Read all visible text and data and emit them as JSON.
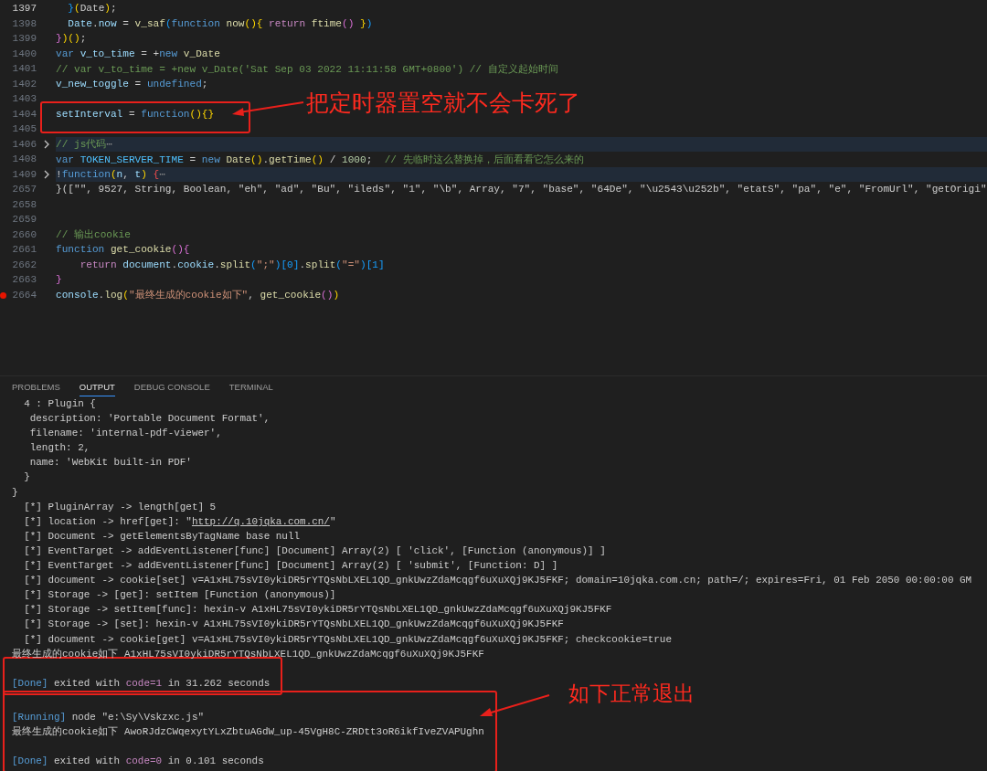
{
  "code_lines": [
    {
      "number": "1397",
      "current": true,
      "folded": false,
      "breakpoint": false,
      "segments": [
        {
          "kind": "b3",
          "text": "  }"
        },
        {
          "kind": "b1",
          "text": "("
        },
        {
          "kind": "p",
          "text": "Date"
        },
        {
          "kind": "b1",
          "text": ")"
        },
        {
          "kind": "p",
          "text": ";"
        }
      ]
    },
    {
      "number": "1398",
      "current": false,
      "folded": false,
      "breakpoint": false,
      "segments": [
        {
          "kind": "var",
          "text": "  Date"
        },
        {
          "kind": "p",
          "text": "."
        },
        {
          "kind": "var",
          "text": "now"
        },
        {
          "kind": "p",
          "text": " = "
        },
        {
          "kind": "fn",
          "text": "v_saf"
        },
        {
          "kind": "b3",
          "text": "("
        },
        {
          "kind": "kw",
          "text": "function "
        },
        {
          "kind": "fn",
          "text": "now"
        },
        {
          "kind": "b1",
          "text": "(){"
        },
        {
          "kind": "ctl",
          "text": " return "
        },
        {
          "kind": "fn",
          "text": "ftime"
        },
        {
          "kind": "b2",
          "text": "()"
        },
        {
          "kind": "b1",
          "text": " }"
        },
        {
          "kind": "b3",
          "text": ")"
        }
      ]
    },
    {
      "number": "1399",
      "current": false,
      "folded": false,
      "breakpoint": false,
      "segments": [
        {
          "kind": "b2",
          "text": "}"
        },
        {
          "kind": "b1",
          "text": ")()"
        },
        {
          "kind": "p",
          "text": ";"
        }
      ]
    },
    {
      "number": "1400",
      "current": false,
      "folded": false,
      "breakpoint": false,
      "segments": [
        {
          "kind": "kw",
          "text": "var "
        },
        {
          "kind": "var",
          "text": "v_to_time"
        },
        {
          "kind": "p",
          "text": " = +"
        },
        {
          "kind": "kw",
          "text": "new "
        },
        {
          "kind": "fn",
          "text": "v_Date"
        }
      ]
    },
    {
      "number": "1401",
      "current": false,
      "folded": false,
      "breakpoint": false,
      "segments": [
        {
          "kind": "cmt",
          "text": "// var v_to_time = +new v_Date('Sat Sep 03 2022 11:11:58 GMT+0800') // 自定义起始时间"
        }
      ]
    },
    {
      "number": "1402",
      "current": false,
      "folded": false,
      "breakpoint": false,
      "segments": [
        {
          "kind": "var",
          "text": "v_new_toggle"
        },
        {
          "kind": "p",
          "text": " = "
        },
        {
          "kind": "kw",
          "text": "undefined"
        },
        {
          "kind": "p",
          "text": ";"
        }
      ]
    },
    {
      "number": "1403",
      "current": false,
      "folded": false,
      "breakpoint": false
    },
    {
      "number": "1404",
      "current": false,
      "folded": false,
      "breakpoint": false,
      "segments": [
        {
          "kind": "var",
          "text": "setInterval"
        },
        {
          "kind": "p",
          "text": " = "
        },
        {
          "kind": "kw",
          "text": "function"
        },
        {
          "kind": "b1",
          "text": "(){}"
        }
      ]
    },
    {
      "number": "1405",
      "current": false,
      "folded": false,
      "breakpoint": false
    },
    {
      "number": "1406",
      "current": false,
      "folded": true,
      "breakpoint": false,
      "segments": [
        {
          "kind": "cmt",
          "text": "// js代码"
        },
        {
          "kind": "fold",
          "text": "⋯"
        }
      ]
    },
    {
      "number": "1408",
      "current": false,
      "folded": false,
      "breakpoint": false,
      "segments": [
        {
          "kind": "kw",
          "text": "var "
        },
        {
          "kind": "const",
          "text": "TOKEN_SERVER_TIME"
        },
        {
          "kind": "p",
          "text": " = "
        },
        {
          "kind": "kw",
          "text": "new "
        },
        {
          "kind": "fn",
          "text": "Date"
        },
        {
          "kind": "b1",
          "text": "()"
        },
        {
          "kind": "p",
          "text": "."
        },
        {
          "kind": "fn",
          "text": "getTime"
        },
        {
          "kind": "b1",
          "text": "()"
        },
        {
          "kind": "p",
          "text": " / "
        },
        {
          "kind": "num",
          "text": "1000"
        },
        {
          "kind": "p",
          "text": ";"
        },
        {
          "kind": "cmt",
          "text": "  // 先临时这么替换掉，后面看看它怎么来的"
        }
      ]
    },
    {
      "number": "1409",
      "current": false,
      "folded": true,
      "breakpoint": false,
      "segments": [
        {
          "kind": "p",
          "text": "!"
        },
        {
          "kind": "kw",
          "text": "function"
        },
        {
          "kind": "b1",
          "text": "("
        },
        {
          "kind": "var",
          "text": "n"
        },
        {
          "kind": "p",
          "text": ", "
        },
        {
          "kind": "var",
          "text": "t"
        },
        {
          "kind": "b1",
          "text": ")"
        },
        {
          "kind": "red",
          "text": " {"
        },
        {
          "kind": "fold",
          "text": "⋯"
        }
      ]
    },
    {
      "number": "2657",
      "current": false,
      "folded": false,
      "breakpoint": false,
      "segments": [
        {
          "kind": "p",
          "text": "}([\"\", 9527, String, Boolean, \"eh\", \"ad\", \"Bu\", \"ileds\", \"1\", \"\\b\", Array, \"7\", \"base\", \"64De\", \"\\u2543\\u252b\", \"etatS\", \"pa\", \"e\", \"FromUrl\", \"getOrigi\""
        }
      ]
    },
    {
      "number": "2658",
      "current": false,
      "folded": false,
      "breakpoint": false
    },
    {
      "number": "2659",
      "current": false,
      "folded": false,
      "breakpoint": false
    },
    {
      "number": "2660",
      "current": false,
      "folded": false,
      "breakpoint": false,
      "segments": [
        {
          "kind": "cmt",
          "text": "// 输出cookie"
        }
      ]
    },
    {
      "number": "2661",
      "current": false,
      "folded": false,
      "breakpoint": false,
      "segments": [
        {
          "kind": "kw",
          "text": "function "
        },
        {
          "kind": "fn",
          "text": "get_cookie"
        },
        {
          "kind": "b2",
          "text": "(){"
        }
      ]
    },
    {
      "number": "2662",
      "current": false,
      "folded": false,
      "breakpoint": false,
      "segments": [
        {
          "kind": "ctl",
          "text": "    return "
        },
        {
          "kind": "var",
          "text": "document"
        },
        {
          "kind": "p",
          "text": "."
        },
        {
          "kind": "var",
          "text": "cookie"
        },
        {
          "kind": "p",
          "text": "."
        },
        {
          "kind": "fn",
          "text": "split"
        },
        {
          "kind": "b3",
          "text": "("
        },
        {
          "kind": "str",
          "text": "\";\""
        },
        {
          "kind": "b3",
          "text": ")[0]"
        },
        {
          "kind": "p",
          "text": "."
        },
        {
          "kind": "fn",
          "text": "split"
        },
        {
          "kind": "b3",
          "text": "("
        },
        {
          "kind": "str",
          "text": "\"=\""
        },
        {
          "kind": "b3",
          "text": ")[1]"
        }
      ]
    },
    {
      "number": "2663",
      "current": false,
      "folded": false,
      "breakpoint": false,
      "segments": [
        {
          "kind": "b2",
          "text": "}"
        }
      ]
    },
    {
      "number": "2664",
      "current": false,
      "folded": false,
      "breakpoint": true,
      "segments": [
        {
          "kind": "var",
          "text": "console"
        },
        {
          "kind": "p",
          "text": "."
        },
        {
          "kind": "fn",
          "text": "log"
        },
        {
          "kind": "b1",
          "text": "("
        },
        {
          "kind": "str",
          "text": "\"最终生成的cookie如下\""
        },
        {
          "kind": "p",
          "text": ", "
        },
        {
          "kind": "fn",
          "text": "get_cookie"
        },
        {
          "kind": "b2",
          "text": "()"
        },
        {
          "kind": "b1",
          "text": ")"
        }
      ]
    }
  ],
  "panel_tabs": [
    {
      "label": "PROBLEMS",
      "selected": false
    },
    {
      "label": "OUTPUT",
      "selected": true
    },
    {
      "label": "DEBUG CONSOLE",
      "selected": false
    },
    {
      "label": "TERMINAL",
      "selected": false
    }
  ],
  "output_blocks": [
    {
      "lines": [
        [
          {
            "kind": "p",
            "text": "  4 : Plugin {"
          }
        ],
        [
          {
            "kind": "p",
            "text": "   description: 'Portable Document Format',"
          }
        ],
        [
          {
            "kind": "p",
            "text": "   filename: 'internal-pdf-viewer',"
          }
        ],
        [
          {
            "kind": "p",
            "text": "   length: 2,"
          }
        ],
        [
          {
            "kind": "p",
            "text": "   name: 'WebKit built-in PDF'"
          }
        ],
        [
          {
            "kind": "p",
            "text": "  }"
          }
        ],
        [
          {
            "kind": "p",
            "text": "}"
          }
        ],
        [
          {
            "kind": "p",
            "text": "  [*] PluginArray -> length[get] 5"
          }
        ],
        [
          {
            "kind": "p",
            "text": "  [*] location -> href[get]: \""
          },
          {
            "kind": "link",
            "text": "http://q.10jqka.com.cn/"
          },
          {
            "kind": "p",
            "text": "\""
          }
        ],
        [
          {
            "kind": "p",
            "text": "  [*] Document -> getElementsByTagName base null"
          }
        ],
        [
          {
            "kind": "p",
            "text": "  [*] EventTarget -> addEventListener[func] [Document] Array(2) [ 'click', [Function (anonymous)] ]"
          }
        ],
        [
          {
            "kind": "p",
            "text": "  [*] EventTarget -> addEventListener[func] [Document] Array(2) [ 'submit', [Function: D] ]"
          }
        ],
        [
          {
            "kind": "p",
            "text": "  [*] document -> cookie[set] v=A1xHL75sVI0ykiDR5rYTQsNbLXEL1QD_gnkUwzZdaMcqgf6uXuXQj9KJ5FKF; domain=10jqka.com.cn; path=/; expires=Fri, 01 Feb 2050 00:00:00 GM"
          }
        ],
        [
          {
            "kind": "p",
            "text": "  [*] Storage -> [get]: setItem [Function (anonymous)]"
          }
        ],
        [
          {
            "kind": "p",
            "text": "  [*] Storage -> setItem[func]: hexin-v A1xHL75sVI0ykiDR5rYTQsNbLXEL1QD_gnkUwzZdaMcqgf6uXuXQj9KJ5FKF"
          }
        ],
        [
          {
            "kind": "p",
            "text": "  [*] Storage -> [set]: hexin-v A1xHL75sVI0ykiDR5rYTQsNbLXEL1QD_gnkUwzZdaMcqgf6uXuXQj9KJ5FKF"
          }
        ],
        [
          {
            "kind": "p",
            "text": "  [*] document -> cookie[get] v=A1xHL75sVI0ykiDR5rYTQsNbLXEL1QD_gnkUwzZdaMcqgf6uXuXQj9KJ5FKF; checkcookie=true"
          }
        ],
        [
          {
            "kind": "p",
            "text": "最终生成的cookie如下 A1xHL75sVI0ykiDR5rYTQsNbLXEL1QD_gnkUwzZdaMcqgf6uXuXQj9KJ5FKF"
          }
        ]
      ]
    },
    {
      "lines": [
        [
          {
            "kind": "tag",
            "text": "[Done]"
          },
          {
            "kind": "p",
            "text": " exited with "
          },
          {
            "kind": "code",
            "text": "code=1"
          },
          {
            "kind": "p",
            "text": " in 31.262 seconds"
          }
        ]
      ]
    },
    {
      "lines": [
        [
          {
            "kind": "tag",
            "text": "[Running]"
          },
          {
            "kind": "p",
            "text": " node \"e:\\Sy\\Vskzxc.js\""
          }
        ],
        [
          {
            "kind": "p",
            "text": "最终生成的cookie如下 AwoRJdzCWqexytYLxZbtuAGdW_up-45VgH8C-ZRDtt3oR6ikfIveZVAPUghn"
          }
        ]
      ]
    },
    {
      "lines": [
        [
          {
            "kind": "tag",
            "text": "[Done]"
          },
          {
            "kind": "p",
            "text": " exited with "
          },
          {
            "kind": "code",
            "text": "code=0"
          },
          {
            "kind": "p",
            "text": " in 0.101 seconds"
          }
        ]
      ]
    }
  ],
  "annotations": [
    {
      "text": "把定时器置空就不会卡死了"
    },
    {
      "text": "如下正常退出"
    }
  ]
}
